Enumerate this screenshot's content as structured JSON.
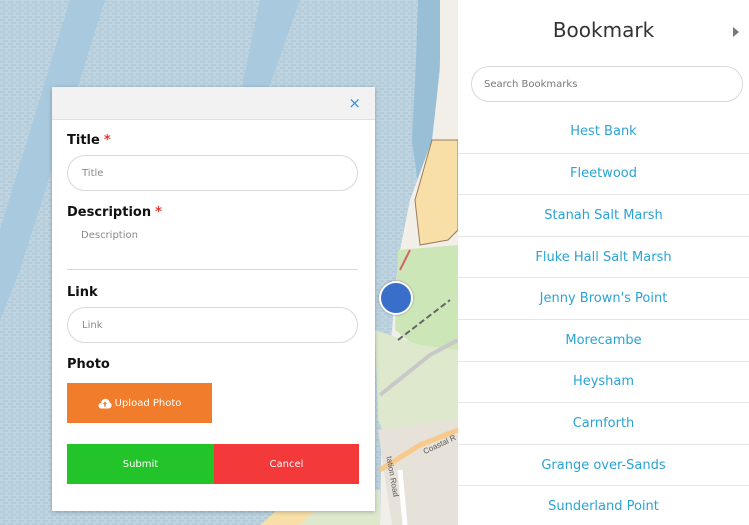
{
  "modal": {
    "close_glyph": "×",
    "title_label": "Title",
    "title_placeholder": "Title",
    "description_label": "Description",
    "description_placeholder": "Description",
    "link_label": "Link",
    "link_placeholder": "Link",
    "photo_label": "Photo",
    "upload_label": "Upload Photo",
    "upload_icon": "cloud-upload-icon",
    "submit_label": "Submit",
    "cancel_label": "Cancel",
    "required_mark": "*"
  },
  "panel": {
    "title": "Bookmark",
    "search_placeholder": "Search Bookmarks",
    "bookmarks": [
      "Hest Bank",
      "Fleetwood",
      "Stanah Salt Marsh",
      "Fluke Hall Salt Marsh",
      "Jenny Brown's Point",
      "Morecambe",
      "Heysham",
      "Carnforth",
      "Grange over-Sands",
      "Sunderland Point"
    ]
  },
  "map": {
    "labels": {
      "coastal_road": "Coastal R",
      "station_road": "tation Road"
    }
  },
  "colors": {
    "accent_link": "#2aa3d4",
    "upload": "#f07c2c",
    "submit": "#23c32a",
    "cancel": "#f4393b",
    "required": "#e53935"
  }
}
